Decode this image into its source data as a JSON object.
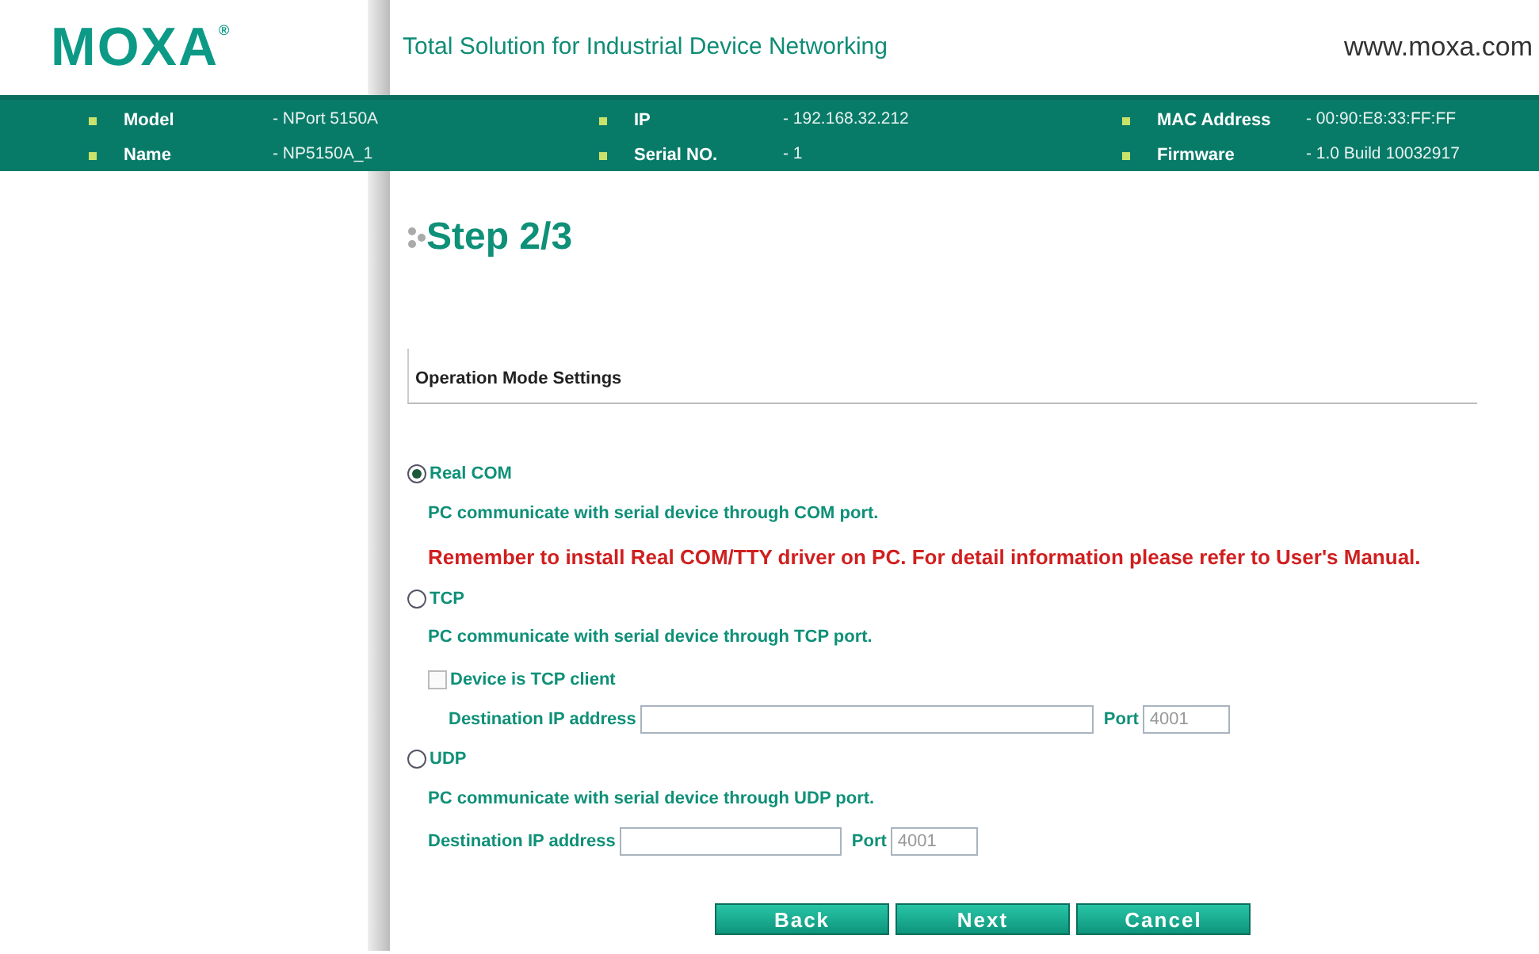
{
  "header": {
    "logo": "MOXA",
    "logo_mark": "®",
    "tagline": "Total Solution for Industrial Device Networking",
    "website": "www.moxa.com"
  },
  "info": [
    {
      "label": "Model",
      "value": "- NPort 5150A"
    },
    {
      "label": "IP",
      "value": "- 192.168.32.212"
    },
    {
      "label": "MAC Address",
      "value": "- 00:90:E8:33:FF:FF"
    },
    {
      "label": "Name",
      "value": "- NP5150A_1"
    },
    {
      "label": "Serial NO.",
      "value": "- 1"
    },
    {
      "label": "Firmware",
      "value": "- 1.0 Build 10032917"
    }
  ],
  "title": "Step 2/3",
  "section": "Operation Mode Settings",
  "modes": [
    {
      "label": "Real COM",
      "selected": true,
      "description": "PC communicate with serial device through COM port.",
      "note": "Remember to install Real COM/TTY driver on PC. For detail information please refer to User's Manual."
    },
    {
      "label": "TCP",
      "selected": false,
      "description": "PC communicate with serial device through TCP port.",
      "checkbox": {
        "label": "Device is TCP client",
        "checked": false
      },
      "fields": {
        "ip_label": "Destination IP address",
        "port_label": "Port",
        "port_value": "4001",
        "wide": true
      }
    },
    {
      "label": "UDP",
      "selected": false,
      "description": "PC communicate with serial device through UDP port.",
      "fields": {
        "ip_label": "Destination IP address",
        "port_label": "Port",
        "port_value": "4001",
        "wide": false
      }
    }
  ],
  "buttons": [
    "Back",
    "Next",
    "Cancel"
  ]
}
